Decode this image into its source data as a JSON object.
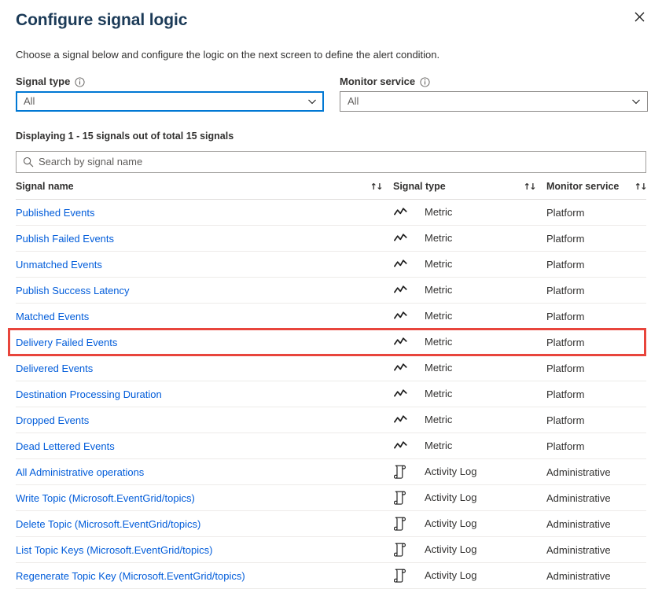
{
  "header": {
    "title": "Configure signal logic",
    "close_label": "Close",
    "close_icon": "close-icon"
  },
  "description": "Choose a signal below and configure the logic on the next screen to define the alert condition.",
  "filters": [
    {
      "label": "Signal type",
      "info_icon": "info-icon",
      "value": "All",
      "focused": true
    },
    {
      "label": "Monitor service",
      "info_icon": "info-icon",
      "value": "All",
      "focused": false
    }
  ],
  "displaying": "Displaying 1 - 15 signals out of total 15 signals",
  "search": {
    "placeholder": "Search by signal name",
    "value": "",
    "icon": "search-icon"
  },
  "table": {
    "columns": [
      {
        "label": "Signal name",
        "sort_icon": "↑↓"
      },
      {
        "label": "Signal type",
        "sort_icon": "↑↓"
      },
      {
        "label": "Monitor service",
        "sort_icon": "↑↓"
      }
    ],
    "rows": [
      {
        "name": "Published Events",
        "type": "Metric",
        "type_icon": "metric-line-chart-icon",
        "service": "Platform",
        "highlighted": false
      },
      {
        "name": "Publish Failed Events",
        "type": "Metric",
        "type_icon": "metric-line-chart-icon",
        "service": "Platform",
        "highlighted": false
      },
      {
        "name": "Unmatched Events",
        "type": "Metric",
        "type_icon": "metric-line-chart-icon",
        "service": "Platform",
        "highlighted": false
      },
      {
        "name": "Publish Success Latency",
        "type": "Metric",
        "type_icon": "metric-line-chart-icon",
        "service": "Platform",
        "highlighted": false
      },
      {
        "name": "Matched Events",
        "type": "Metric",
        "type_icon": "metric-line-chart-icon",
        "service": "Platform",
        "highlighted": false
      },
      {
        "name": "Delivery Failed Events",
        "type": "Metric",
        "type_icon": "metric-line-chart-icon",
        "service": "Platform",
        "highlighted": true
      },
      {
        "name": "Delivered Events",
        "type": "Metric",
        "type_icon": "metric-line-chart-icon",
        "service": "Platform",
        "highlighted": false
      },
      {
        "name": "Destination Processing Duration",
        "type": "Metric",
        "type_icon": "metric-line-chart-icon",
        "service": "Platform",
        "highlighted": false
      },
      {
        "name": "Dropped Events",
        "type": "Metric",
        "type_icon": "metric-line-chart-icon",
        "service": "Platform",
        "highlighted": false
      },
      {
        "name": "Dead Lettered Events",
        "type": "Metric",
        "type_icon": "metric-line-chart-icon",
        "service": "Platform",
        "highlighted": false
      },
      {
        "name": "All Administrative operations",
        "type": "Activity Log",
        "type_icon": "activity-log-scroll-icon",
        "service": "Administrative",
        "highlighted": false
      },
      {
        "name": "Write Topic (Microsoft.EventGrid/topics)",
        "type": "Activity Log",
        "type_icon": "activity-log-scroll-icon",
        "service": "Administrative",
        "highlighted": false
      },
      {
        "name": "Delete Topic (Microsoft.EventGrid/topics)",
        "type": "Activity Log",
        "type_icon": "activity-log-scroll-icon",
        "service": "Administrative",
        "highlighted": false
      },
      {
        "name": "List Topic Keys (Microsoft.EventGrid/topics)",
        "type": "Activity Log",
        "type_icon": "activity-log-scroll-icon",
        "service": "Administrative",
        "highlighted": false
      },
      {
        "name": "Regenerate Topic Key (Microsoft.EventGrid/topics)",
        "type": "Activity Log",
        "type_icon": "activity-log-scroll-icon",
        "service": "Administrative",
        "highlighted": false
      }
    ]
  },
  "colors": {
    "link": "#015cda",
    "accent": "#0078d4",
    "highlight": "#e8453c",
    "title": "#1b3a57",
    "text": "#323130"
  }
}
